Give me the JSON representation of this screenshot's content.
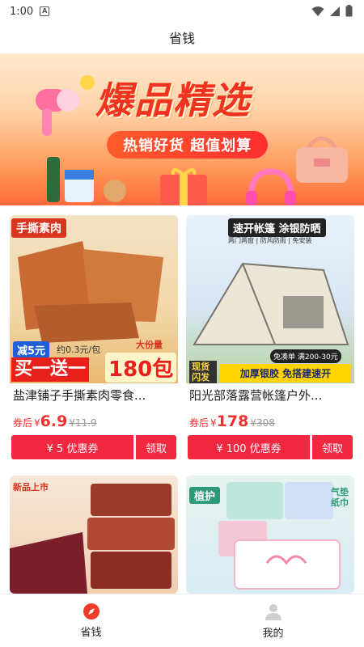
{
  "status_bar": {
    "time": "1:00",
    "badge": "A"
  },
  "title": "省钱",
  "banner": {
    "title": "爆品精选",
    "subtitle": "热销好货 超值划算"
  },
  "products": [
    {
      "image_tag": "手撕素肉",
      "image_promo_small": "减5元",
      "image_promo_unit": "约0.3元/包",
      "image_promo_qty_label": "大份量",
      "image_promo_main": "买一送一",
      "image_promo_count": "180包",
      "name": "盐津铺子手撕素肉零食...",
      "price_label": "券后",
      "price_symbol": "¥",
      "price": "6.9",
      "original_price": "¥11.9",
      "coupon": "¥ 5 优惠券",
      "claim": "领取"
    },
    {
      "image_tag": "速开帐篷 涂银防晒",
      "image_subtags": "两门两窗 | 防风防雨 | 免安装",
      "image_badge_left": "现货闪发",
      "image_badge_coupon": "免凑单 满200-30元",
      "image_banner": "加厚银胶 免搭建速开",
      "name": "阳光部落露营帐篷户外...",
      "price_label": "券后",
      "price_symbol": "¥",
      "price": "178",
      "original_price": "¥308",
      "coupon": "¥ 100 优惠券",
      "claim": "领取"
    },
    {
      "image_tag": "新品上市"
    },
    {
      "image_tag": "植护",
      "image_side_tag": "气垫纸巾"
    }
  ],
  "nav": [
    {
      "label": "省钱",
      "icon": "compass-icon",
      "active": true
    },
    {
      "label": "我的",
      "icon": "user-icon",
      "active": false
    }
  ],
  "colors": {
    "accent": "#f22840",
    "price": "#f23030",
    "banner_title": "#f0331e"
  }
}
